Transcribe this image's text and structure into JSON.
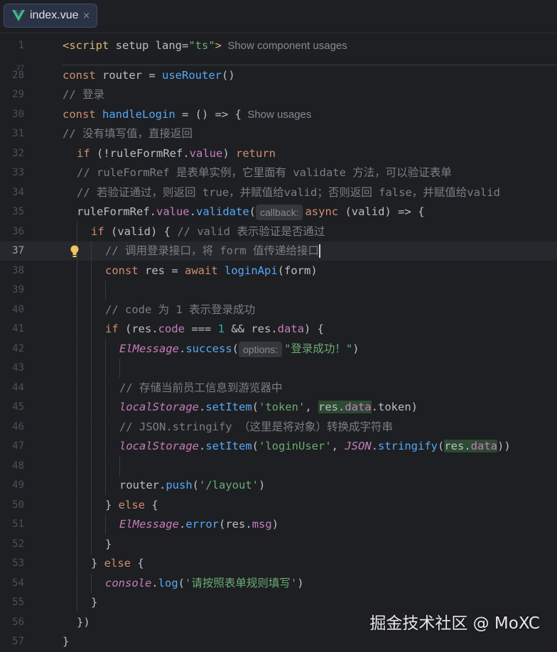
{
  "tab": {
    "label": "index.vue",
    "close": "×",
    "icon": "vue-logo-icon"
  },
  "watermark": "掘金技术社区 @ MoXC",
  "fold_marker": "27",
  "colors": {
    "keyword": "#cf8e6d",
    "function": "#56a8f5",
    "string": "#6aab73",
    "comment": "#7a7e85",
    "property": "#c77dbb",
    "number": "#2aacb8",
    "tag": "#d5b778"
  },
  "lines": [
    {
      "n": "1",
      "tokens": [
        [
          "tag",
          "<script "
        ],
        [
          "plain",
          "setup "
        ],
        [
          "plain",
          "lang="
        ],
        [
          "str",
          "\"ts\""
        ],
        [
          "tag",
          ">"
        ]
      ],
      "hint": "Show component usages"
    },
    {
      "n": "28",
      "tokens": [
        [
          "kw",
          "const "
        ],
        [
          "plain",
          "router = "
        ],
        [
          "fn",
          "useRouter"
        ],
        [
          "plain",
          "()"
        ]
      ]
    },
    {
      "n": "29",
      "tokens": [
        [
          "cm",
          "// 登录"
        ]
      ]
    },
    {
      "n": "30",
      "tokens": [
        [
          "kw",
          "const "
        ],
        [
          "fn",
          "handleLogin"
        ],
        [
          "plain",
          " = () => {"
        ]
      ],
      "hint": "Show usages"
    },
    {
      "n": "31",
      "tokens": [
        [
          "cm",
          "// 没有填写值，直接返回"
        ]
      ]
    },
    {
      "n": "32",
      "tokens": [
        [
          "kw",
          "if "
        ],
        [
          "plain",
          "(!ruleFormRef."
        ],
        [
          "prop",
          "value"
        ],
        [
          "plain",
          ") "
        ],
        [
          "kw",
          "return"
        ]
      ]
    },
    {
      "n": "33",
      "tokens": [
        [
          "cm",
          "// ruleFormRef 是表单实例，它里面有 validate 方法，可以验证表单"
        ]
      ]
    },
    {
      "n": "34",
      "tokens": [
        [
          "cm",
          "// 若验证通过，则返回 true，并赋值给valid；否则返回 false，并赋值给valid"
        ]
      ]
    },
    {
      "n": "35",
      "tokens": [
        [
          "plain",
          "ruleFormRef."
        ],
        [
          "prop",
          "value"
        ],
        [
          "plain",
          "."
        ],
        [
          "fn",
          "validate"
        ],
        [
          "plain",
          "("
        ],
        [
          "inlay",
          "callback:"
        ],
        [
          "kw",
          "async "
        ],
        [
          "plain",
          "(valid) => {"
        ]
      ]
    },
    {
      "n": "36",
      "tokens": [
        [
          "kw",
          "if "
        ],
        [
          "plain",
          "(valid) { "
        ],
        [
          "cm",
          "// valid 表示验证是否通过"
        ]
      ]
    },
    {
      "n": "37",
      "tokens": [
        [
          "cm",
          "// 调用登录接口，将 form 值传递给接口"
        ]
      ]
    },
    {
      "n": "38",
      "tokens": [
        [
          "kw",
          "const "
        ],
        [
          "plain",
          "res = "
        ],
        [
          "kw",
          "await "
        ],
        [
          "fn",
          "loginApi"
        ],
        [
          "plain",
          "(form)"
        ]
      ]
    },
    {
      "n": "39",
      "tokens": []
    },
    {
      "n": "40",
      "tokens": [
        [
          "cm",
          "// code 为 1 表示登录成功"
        ]
      ]
    },
    {
      "n": "41",
      "tokens": [
        [
          "kw",
          "if "
        ],
        [
          "plain",
          "(res."
        ],
        [
          "prop",
          "code"
        ],
        [
          "plain",
          " === "
        ],
        [
          "num",
          "1"
        ],
        [
          "plain",
          " && res."
        ],
        [
          "prop",
          "data"
        ],
        [
          "plain",
          ") {"
        ]
      ]
    },
    {
      "n": "42",
      "tokens": [
        [
          "it",
          "ElMessage"
        ],
        [
          "plain",
          "."
        ],
        [
          "fn",
          "success"
        ],
        [
          "plain",
          "("
        ],
        [
          "inlay",
          "options:"
        ],
        [
          "str",
          "\"登录成功！\""
        ],
        [
          "plain",
          ")"
        ]
      ]
    },
    {
      "n": "43",
      "tokens": []
    },
    {
      "n": "44",
      "tokens": [
        [
          "cm",
          "// 存储当前员工信息到游览器中"
        ]
      ]
    },
    {
      "n": "45",
      "tokens": [
        [
          "it",
          "localStorage"
        ],
        [
          "plain",
          "."
        ],
        [
          "fn",
          "setItem"
        ],
        [
          "plain",
          "("
        ],
        [
          "str",
          "'token'"
        ],
        [
          "plain",
          ", "
        ],
        [
          "hlplain",
          "res."
        ],
        [
          "hlprop",
          "data"
        ],
        [
          "plain",
          "."
        ],
        [
          "plain",
          "token)"
        ]
      ]
    },
    {
      "n": "46",
      "tokens": [
        [
          "cm",
          "// JSON.stringify （这里是将对象）转换成字符串"
        ]
      ]
    },
    {
      "n": "47",
      "tokens": [
        [
          "it",
          "localStorage"
        ],
        [
          "plain",
          "."
        ],
        [
          "fn",
          "setItem"
        ],
        [
          "plain",
          "("
        ],
        [
          "str",
          "'loginUser'"
        ],
        [
          "plain",
          ", "
        ],
        [
          "it",
          "JSON"
        ],
        [
          "plain",
          "."
        ],
        [
          "fn",
          "stringify"
        ],
        [
          "plain",
          "("
        ],
        [
          "hlplain",
          "res."
        ],
        [
          "hlprop",
          "data"
        ],
        [
          "plain",
          "))"
        ]
      ]
    },
    {
      "n": "48",
      "tokens": []
    },
    {
      "n": "49",
      "tokens": [
        [
          "plain",
          "router."
        ],
        [
          "fn",
          "push"
        ],
        [
          "plain",
          "("
        ],
        [
          "str",
          "'/layout'"
        ],
        [
          "plain",
          ")"
        ]
      ]
    },
    {
      "n": "50",
      "tokens": [
        [
          "plain",
          "} "
        ],
        [
          "kw",
          "else "
        ],
        [
          "plain",
          "{"
        ]
      ]
    },
    {
      "n": "51",
      "tokens": [
        [
          "it",
          "ElMessage"
        ],
        [
          "plain",
          "."
        ],
        [
          "fn",
          "error"
        ],
        [
          "plain",
          "(res."
        ],
        [
          "prop",
          "msg"
        ],
        [
          "plain",
          ")"
        ]
      ]
    },
    {
      "n": "52",
      "tokens": [
        [
          "plain",
          "}"
        ]
      ]
    },
    {
      "n": "53",
      "tokens": [
        [
          "plain",
          "} "
        ],
        [
          "kw",
          "else "
        ],
        [
          "plain",
          "{"
        ]
      ]
    },
    {
      "n": "54",
      "tokens": [
        [
          "it",
          "console"
        ],
        [
          "plain",
          "."
        ],
        [
          "fn",
          "log"
        ],
        [
          "plain",
          "("
        ],
        [
          "str",
          "'请按照表单规则填写'"
        ],
        [
          "plain",
          ")"
        ]
      ]
    },
    {
      "n": "55",
      "tokens": [
        [
          "plain",
          "}"
        ]
      ]
    },
    {
      "n": "56",
      "tokens": [
        [
          "plain",
          "})"
        ]
      ]
    },
    {
      "n": "57",
      "tokens": [
        [
          "plain",
          "}"
        ]
      ]
    }
  ]
}
